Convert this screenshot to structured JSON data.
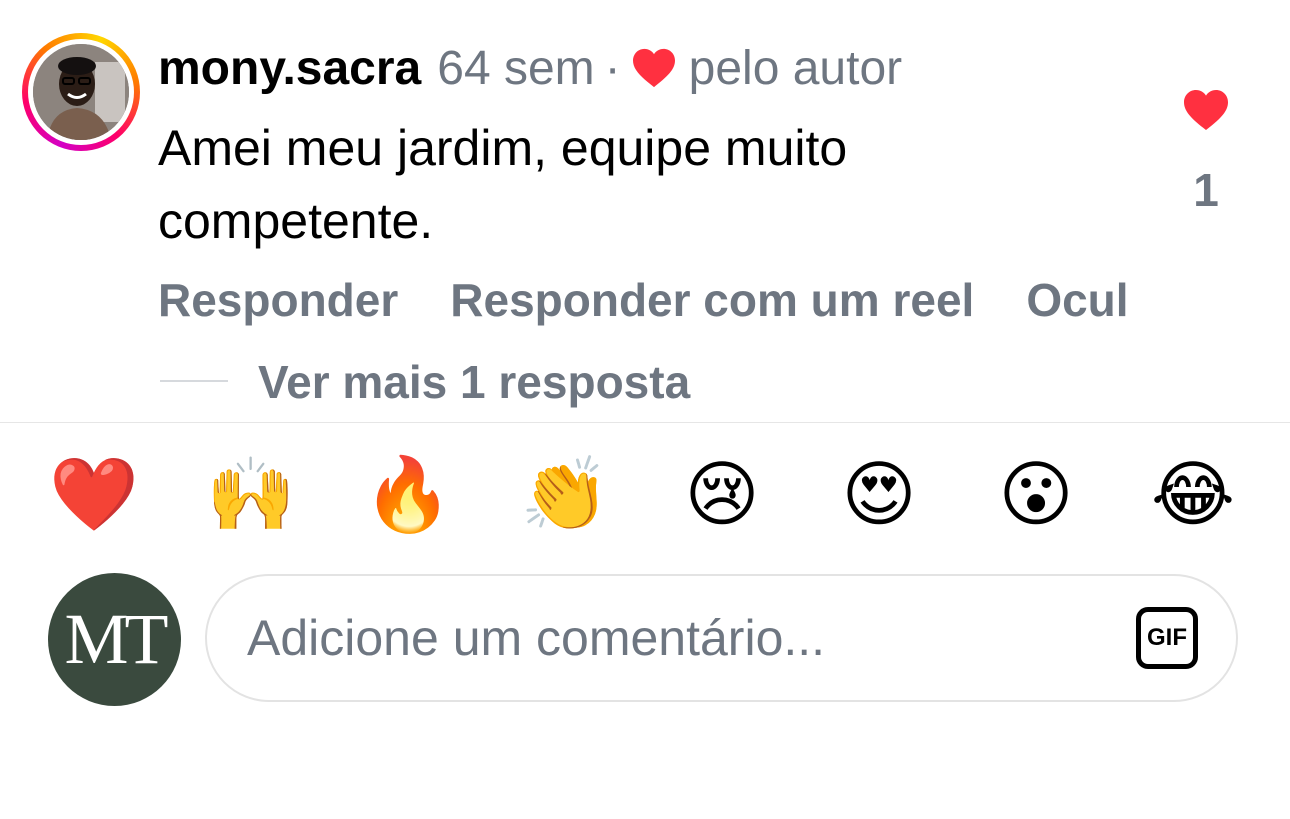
{
  "comment": {
    "username": "mony.sacra",
    "time": "64 sem",
    "separator": "·",
    "liked_by_author": "pelo autor",
    "text": "Amei meu jardim, equipe muito competente.",
    "like_count": "1",
    "actions": {
      "reply": "Responder",
      "reply_reel": "Responder com um reel",
      "hide": "Ocul"
    },
    "view_replies": "Ver mais 1 resposta"
  },
  "emoji_reactions": [
    "❤️",
    "🙌",
    "🔥",
    "👏",
    "😢",
    "😍",
    "😮",
    "😂"
  ],
  "composer": {
    "avatar_text": "MT",
    "placeholder": "Adicione um comentário...",
    "gif_label": "GIF"
  },
  "colors": {
    "heart": "#ff3040",
    "muted_text": "#6e7681",
    "avatar_bg": "#3a4a3e"
  }
}
